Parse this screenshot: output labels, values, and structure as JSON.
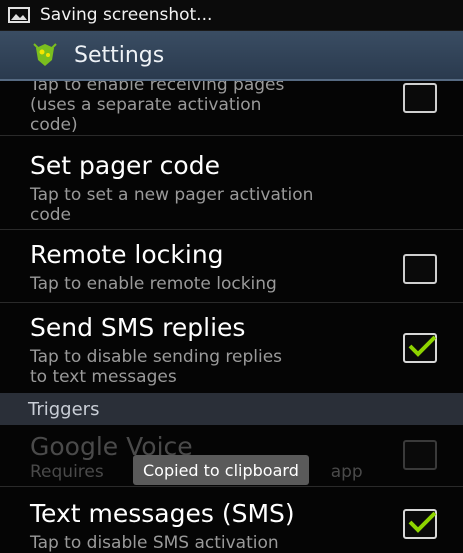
{
  "status_bar": {
    "notification_icon": "image-icon",
    "text": "Saving screenshot..."
  },
  "action_bar": {
    "app_icon": "app-logo-icon",
    "title": "Settings"
  },
  "prefs": [
    {
      "title": "",
      "summary": "Tap to enable receiving pages\n(uses a separate activation\ncode)",
      "checkbox": "unchecked",
      "enabled": true
    },
    {
      "title": "Set pager code",
      "summary": "Tap to set a new pager activation\ncode",
      "checkbox": "none",
      "enabled": true
    },
    {
      "title": "Remote locking",
      "summary": "Tap to enable remote locking",
      "checkbox": "unchecked",
      "enabled": true
    },
    {
      "title": "Send SMS replies",
      "summary": "Tap to disable sending replies\nto text messages",
      "checkbox": "checked",
      "enabled": true
    },
    {
      "title": "Google Voice",
      "summary": "Requires                                          app",
      "checkbox": "unchecked",
      "enabled": false
    },
    {
      "title": "Text messages (SMS)",
      "summary": "Tap to disable SMS activation",
      "checkbox": "checked",
      "enabled": true
    }
  ],
  "section_header": {
    "label": "Triggers"
  },
  "toast": {
    "text": "Copied to clipboard"
  },
  "colors": {
    "action_bar": "#2f4157",
    "check_mark": "#8ed400",
    "section_header": "#2a2f38"
  }
}
